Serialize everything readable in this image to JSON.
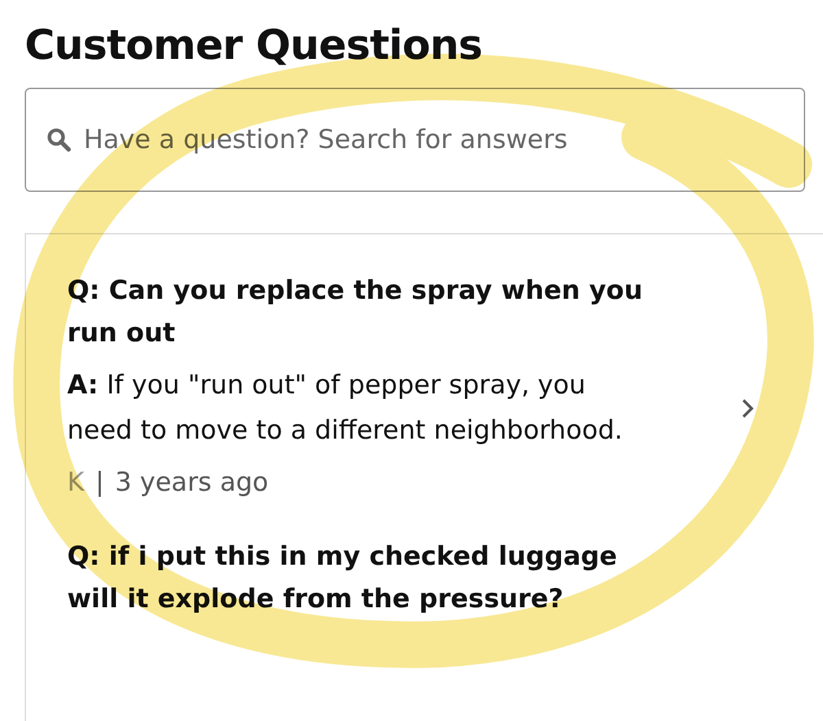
{
  "title": "Customer Questions",
  "search": {
    "placeholder": "Have a question? Search for answers"
  },
  "questions": [
    {
      "question": "Q: Can you replace the spray when you run out",
      "answer": "**A:** If you \"run out\" of pepper spray, you need to move to a different neighborhood.",
      "author": "K",
      "separator": "|",
      "time": "3 years ago"
    },
    {
      "question": "Q: if i put this in my checked luggage will it explode from the pressure?"
    }
  ]
}
